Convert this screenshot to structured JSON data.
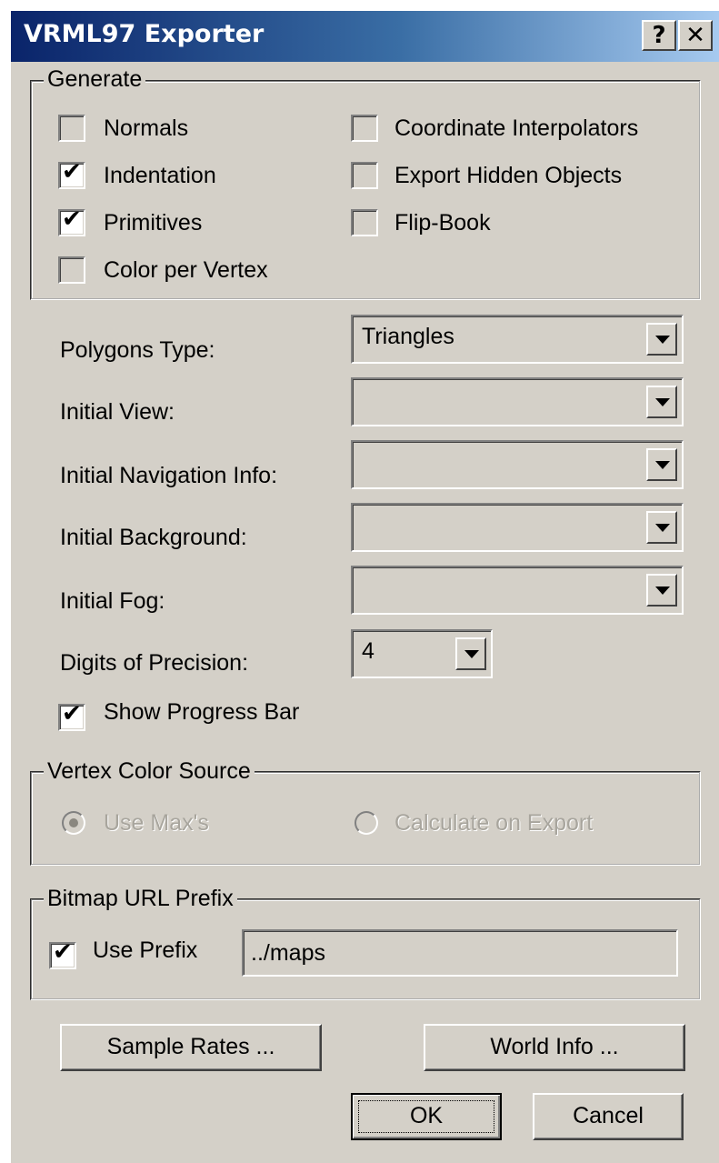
{
  "window": {
    "title": "VRML97 Exporter",
    "help_glyph": "?",
    "close_glyph": "✕"
  },
  "generate": {
    "legend": "Generate",
    "options": [
      {
        "label": "Normals",
        "checked": false
      },
      {
        "label": "Indentation",
        "checked": true
      },
      {
        "label": "Primitives",
        "checked": true
      },
      {
        "label": "Color per Vertex",
        "checked": false
      },
      {
        "label": "Coordinate Interpolators",
        "checked": false
      },
      {
        "label": "Export Hidden Objects",
        "checked": false
      },
      {
        "label": "Flip-Book",
        "checked": false
      }
    ]
  },
  "settings": {
    "polygons_type": {
      "label": "Polygons Type:",
      "value": "Triangles"
    },
    "initial_view": {
      "label": "Initial View:",
      "value": ""
    },
    "initial_navigation_info": {
      "label": "Initial Navigation Info:",
      "value": ""
    },
    "initial_background": {
      "label": "Initial Background:",
      "value": ""
    },
    "initial_fog": {
      "label": "Initial Fog:",
      "value": ""
    },
    "digits_of_precision": {
      "label": "Digits of Precision:",
      "value": "4"
    },
    "show_progress_bar": {
      "label": "Show Progress Bar",
      "checked": true
    }
  },
  "vertex_color_source": {
    "legend": "Vertex Color Source",
    "use_max": {
      "label": "Use Max's",
      "selected": true,
      "enabled": false
    },
    "calculate_on_export": {
      "label": "Calculate on Export",
      "selected": false,
      "enabled": false
    }
  },
  "bitmap_url_prefix": {
    "legend": "Bitmap URL Prefix",
    "use_prefix": {
      "label": "Use Prefix",
      "checked": true
    },
    "prefix_value": "../maps"
  },
  "buttons": {
    "sample_rates": "Sample Rates ...",
    "world_info": "World Info ...",
    "ok": "OK",
    "cancel": "Cancel"
  },
  "colors": {
    "face": "#d4d0c8",
    "titlebar_start": "#0a246a",
    "titlebar_end": "#a6caf0"
  },
  "icons": {
    "check": "check-icon",
    "dropdown": "chevron-down-icon"
  }
}
